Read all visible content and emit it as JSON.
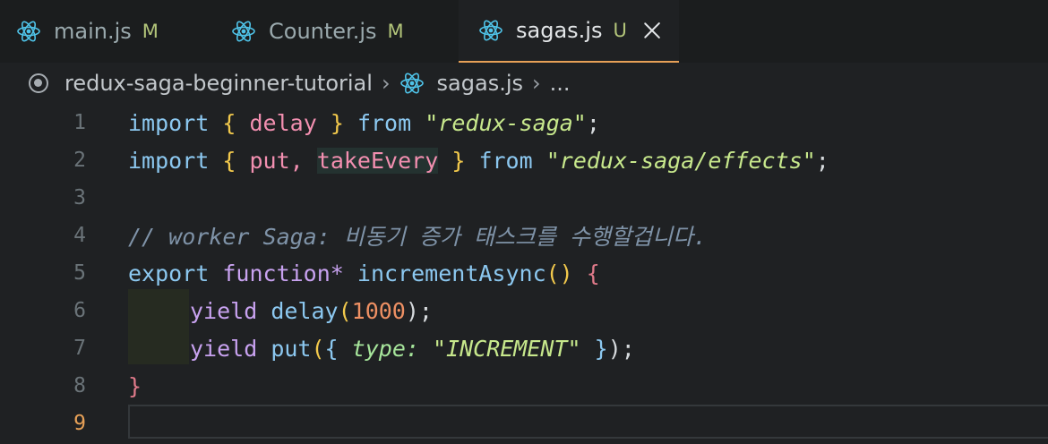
{
  "tabs": [
    {
      "name": "main.js",
      "status": "M",
      "active": false
    },
    {
      "name": "Counter.js",
      "status": "M",
      "active": false
    },
    {
      "name": "sagas.js",
      "status": "U",
      "active": true
    }
  ],
  "breadcrumb": {
    "folder": "redux-saga-beginner-tutorial",
    "file": "sagas.js",
    "more": "..."
  },
  "line_numbers": [
    "1",
    "2",
    "3",
    "4",
    "5",
    "6",
    "7",
    "8",
    "9"
  ],
  "code": {
    "l1": {
      "import": "import",
      "ob": "{",
      "delay": "delay",
      "cb": "}",
      "from": "from",
      "str": "\"redux-saga\"",
      "semi": ";"
    },
    "l2": {
      "import": "import",
      "ob": "{",
      "put": "put,",
      "take": "takeEvery",
      "cb": "}",
      "from": "from",
      "str": "\"redux-saga/effects\"",
      "semi": ";"
    },
    "l4": {
      "comment": "// worker Saga: 비동기 증가 태스크를 수행할겁니다."
    },
    "l5": {
      "export": "export",
      "function": "function*",
      "name": "incrementAsync",
      "parens": "()",
      "ob": "{"
    },
    "l6": {
      "yield": "yield",
      "fn": "delay",
      "op": "(",
      "num": "1000",
      "cp": ");"
    },
    "l7": {
      "yield": "yield",
      "fn": "put",
      "op": "(",
      "ob": "{",
      "key": "type:",
      "str": "\"INCREMENT\"",
      "cb": "}",
      "cp": ");"
    },
    "l8": {
      "cb": "}"
    }
  },
  "colors": {
    "accent": "#e6a057",
    "react": "#4fc3e8",
    "modified": "#b3c57a"
  }
}
